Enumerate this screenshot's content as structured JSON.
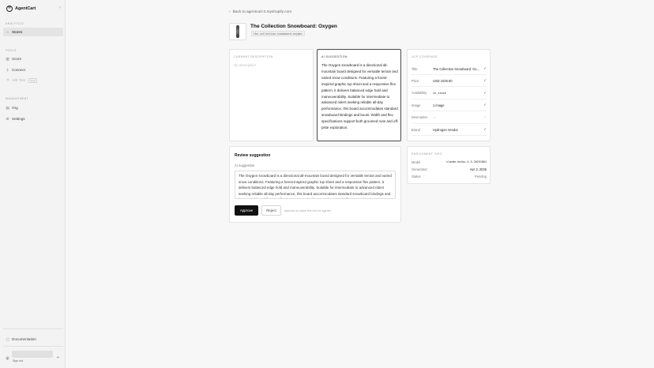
{
  "brand": {
    "name": "AgentCart"
  },
  "sidebar": {
    "sections": {
      "analytics": "ANALYTICS",
      "tools": "TOOLS",
      "management": "MANAGEMENT"
    },
    "items": {
      "stores": "Stores",
      "score": "Score",
      "connect": "Connect",
      "ab_test": "A/B Test",
      "ab_test_badge": "Soon",
      "org": "Org",
      "settings": "Settings",
      "documentation": "Documentation"
    },
    "signout": "Sign out"
  },
  "header": {
    "back_link": "Back to agentcart-2.myshopify.com",
    "product_title": "The Collection Snowboard: Oxygen",
    "product_handle": "the-collection-snowboard-oxygen"
  },
  "current_description": {
    "label": "CURRENT DESCRIPTION",
    "empty_text": "No description"
  },
  "ai_suggestion": {
    "label": "AI SUGGESTION",
    "text": "The Oxygen snowboard is a directional all-mountain board designed for versatile terrain and varied snow conditions. Featuring a forest-inspired graphic top sheet and a responsive flex pattern, it delivers balanced edge hold and maneuverability. Suitable for intermediate to advanced riders seeking reliable all-day performance, this board accommodates standard snowboard bindings and boots. Width and flex specifications support both groomed runs and off-piste exploration."
  },
  "review": {
    "title": "Review suggestion",
    "sublabel": "AI suggestion",
    "textarea_value": "The Oxygen snowboard is a directional all-mountain board designed for versatile terrain and varied snow conditions. Featuring a forest-inspired graphic top sheet and a responsive flex pattern, it delivers balanced edge hold and maneuverability. Suitable for intermediate to advanced riders seeking reliable all-day performance, this board accommodates standard snowboard bindings and boots. Width and flex specifications support both groomed runs and off-piste exploration.",
    "approve_label": "Approve",
    "reject_label": "Reject",
    "approve_hint": "Approve to make this live for agents."
  },
  "ucp_coverage": {
    "label": "UCP COVERAGE",
    "rows": [
      {
        "key": "Title",
        "value": "The Collection Snowboard: Oxygen",
        "check": "✓"
      },
      {
        "key": "Price",
        "value": "USD 1025.00",
        "check": "✓"
      },
      {
        "key": "Availability",
        "value": "in_stock",
        "check": "✓"
      },
      {
        "key": "Image",
        "value": "1 image",
        "check": "✓"
      },
      {
        "key": "Description",
        "value": "—",
        "check": "✓"
      },
      {
        "key": "Brand",
        "value": "Hydrogen Vendor",
        "check": "✓"
      }
    ]
  },
  "enrichment_info": {
    "label": "ENRICHMENT INFO",
    "model_label": "Model",
    "model_value": "claude-haiku-4-5-20251001",
    "generated_label": "Generated",
    "generated_value": "Apr 3, 2026",
    "status_label": "Status",
    "status_value": "Pending"
  }
}
